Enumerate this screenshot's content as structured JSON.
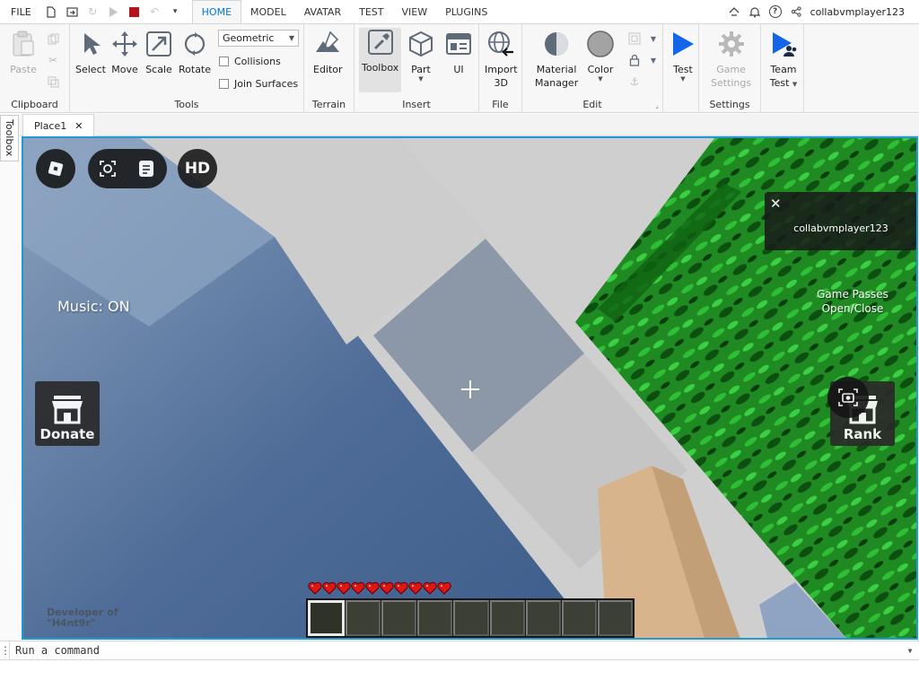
{
  "menubar": {
    "file": "FILE",
    "tabs": [
      "HOME",
      "MODEL",
      "AVATAR",
      "TEST",
      "VIEW",
      "PLUGINS"
    ],
    "active_tab": "HOME",
    "username": "collabvmplayer123"
  },
  "ribbon": {
    "clipboard": {
      "paste": "Paste",
      "label": "Clipboard"
    },
    "tools": {
      "select": "Select",
      "move": "Move",
      "scale": "Scale",
      "rotate": "Rotate",
      "mode_value": "Geometric",
      "collisions": "Collisions",
      "join_surfaces": "Join Surfaces",
      "label": "Tools"
    },
    "terrain": {
      "editor": "Editor",
      "label": "Terrain"
    },
    "insert": {
      "toolbox": "Toolbox",
      "part": "Part",
      "ui": "UI",
      "label": "Insert"
    },
    "file": {
      "import_line1": "Import",
      "import_line2": "3D",
      "label": "File"
    },
    "edit": {
      "material_line1": "Material",
      "material_line2": "Manager",
      "color": "Color",
      "label": "Edit"
    },
    "test": {
      "test": "Test"
    },
    "settings": {
      "game_line1": "Game",
      "game_line2": "Settings",
      "label": "Settings"
    },
    "team": {
      "line1": "Team",
      "line2": "Test"
    }
  },
  "side_tab": "Toolbox",
  "doc_tab": {
    "name": "Place1",
    "close": "✕"
  },
  "viewport": {
    "music": "Music: ON",
    "donate": "Donate",
    "rank": "Rank",
    "hd": "HD",
    "passes_line1": "Game Passes",
    "passes_line2": "Open/Close",
    "notification_user": "collabvmplayer123",
    "notification_close": "✕",
    "developer_line1": "Developer of",
    "developer_line2": "\"H4nt9r\"",
    "hearts": 10,
    "hotbar_slots": 9,
    "hotbar_selected": 1
  },
  "command_bar": {
    "placeholder": "Run a command"
  },
  "colors": {
    "accent": "#0078d7",
    "viewport_border": "#1e9bd6",
    "stop_red": "#b3141e",
    "play_blue": "#1565e8"
  }
}
